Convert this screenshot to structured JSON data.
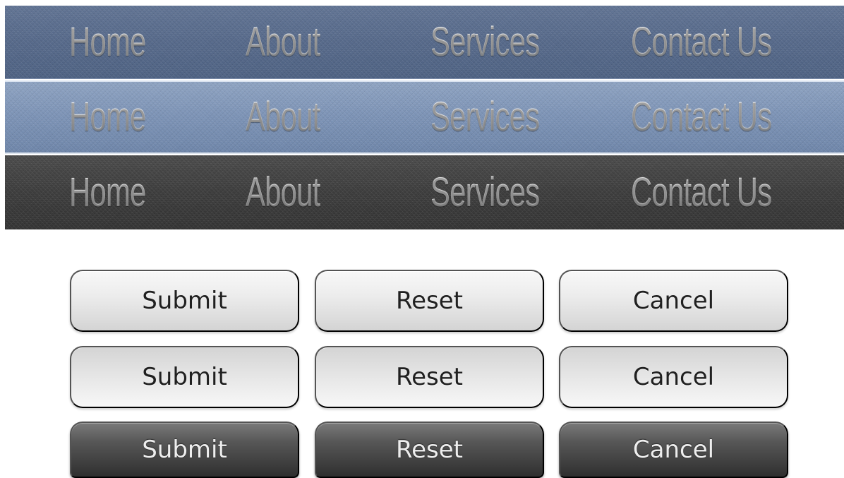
{
  "navbars": [
    {
      "items": [
        {
          "label": "Home"
        },
        {
          "label": "About"
        },
        {
          "label": "Services"
        },
        {
          "label": "Contact Us"
        }
      ]
    },
    {
      "items": [
        {
          "label": "Home"
        },
        {
          "label": "About"
        },
        {
          "label": "Services"
        },
        {
          "label": "Contact Us"
        }
      ]
    },
    {
      "items": [
        {
          "label": "Home"
        },
        {
          "label": "About"
        },
        {
          "label": "Services"
        },
        {
          "label": "Contact Us"
        }
      ]
    }
  ],
  "button_rows": [
    {
      "buttons": [
        {
          "label": "Submit"
        },
        {
          "label": "Reset"
        },
        {
          "label": "Cancel"
        }
      ]
    },
    {
      "buttons": [
        {
          "label": "Submit"
        },
        {
          "label": "Reset"
        },
        {
          "label": "Cancel"
        }
      ]
    },
    {
      "buttons": [
        {
          "label": "Submit"
        },
        {
          "label": "Reset"
        },
        {
          "label": "Cancel"
        }
      ]
    }
  ],
  "colors": {
    "navbar_steel_blue": "#56698a",
    "navbar_light_blue": "#7c93b6",
    "navbar_charcoal": "#3c3c3c",
    "button_light": "#e8e8e8",
    "button_dark": "#4f4f4f",
    "nav_text": "#e7e7e7",
    "button_text_dark": "#202020",
    "button_text_light": "#eeeeee"
  }
}
